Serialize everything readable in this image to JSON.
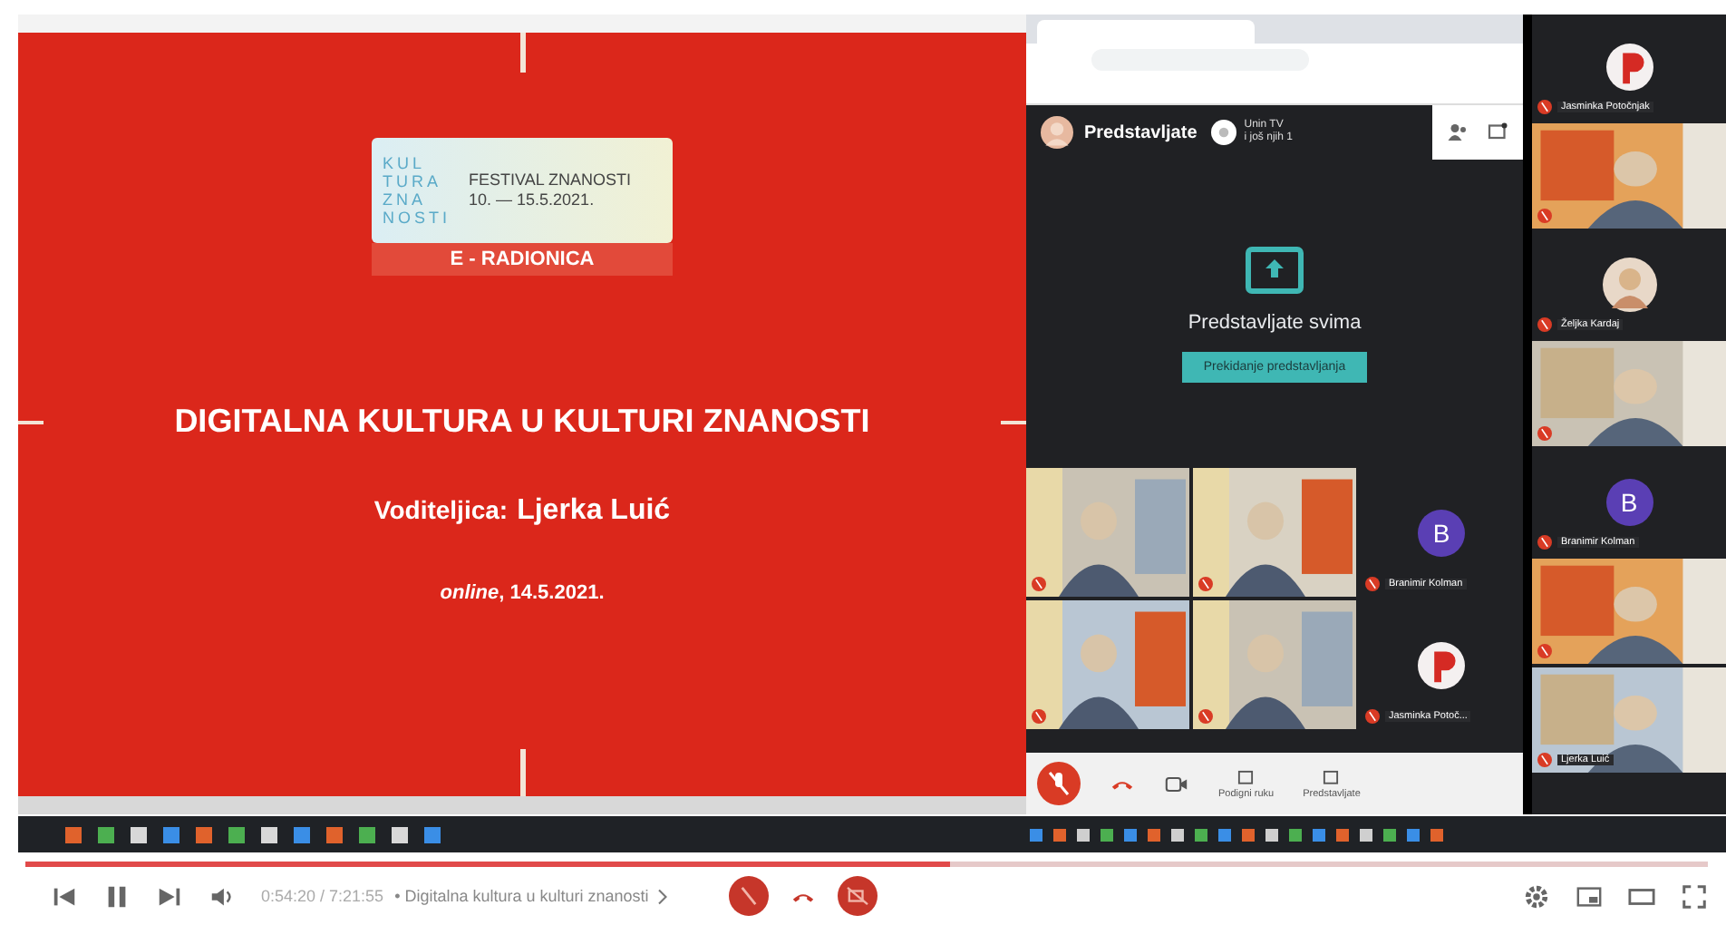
{
  "slide": {
    "logo_lines": [
      "KUL",
      "TURA",
      "ZNA",
      "NOSTI"
    ],
    "festival": "FESTIVAL ZNANOSTI",
    "dates": "10. — 15.5.2021.",
    "subtitle": "E - RADIONICA",
    "title": "DIGITALNA KULTURA U KULTURI ZNANOSTI",
    "presenter_label": "Voditeljica:",
    "presenter": "Ljerka Luić",
    "date": "*online*, 14.5.2021."
  },
  "meet": {
    "presenting_label": "Predstavljate",
    "chip_name": "Unin TV",
    "chip_others": "i još njih 1",
    "share_message": "Predstavljate svima",
    "stop_button": "Prekidanje predstavljanja",
    "tiles": [
      {
        "kind": "video",
        "muted": true
      },
      {
        "kind": "video",
        "muted": true
      },
      {
        "kind": "letter",
        "letter": "B",
        "name": "Branimir Kolman",
        "muted": true
      },
      {
        "kind": "video",
        "muted": true
      },
      {
        "kind": "video",
        "muted": true
      },
      {
        "kind": "logo",
        "name": "Jasminka Potoč...",
        "muted": true
      }
    ],
    "mic_muted": true,
    "actions": [
      "Podigni ruku",
      "Predstavljate"
    ]
  },
  "sidebar": [
    {
      "kind": "logo",
      "name": "Jasminka Potočnjak",
      "muted": true
    },
    {
      "kind": "video",
      "muted": true
    },
    {
      "kind": "round",
      "name": "Željka Kardaj",
      "muted": true
    },
    {
      "kind": "video",
      "muted": true
    },
    {
      "kind": "letter",
      "letter": "B",
      "name": "Branimir Kolman",
      "muted": true
    },
    {
      "kind": "video",
      "muted": true
    },
    {
      "kind": "video",
      "name": "Ljerka Luić",
      "muted": true
    }
  ],
  "player": {
    "level": 0.55,
    "time": "0:54:20 / 7:21:55",
    "chapter": "• Digitalna kultura u kulturi znanosti"
  }
}
